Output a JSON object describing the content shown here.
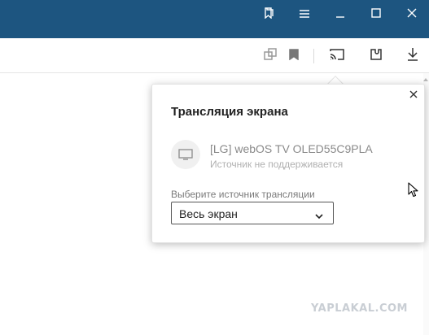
{
  "titlebar": {
    "icons": [
      "bookmarks-panel-icon",
      "menu-icon",
      "minimize-icon",
      "maximize-icon",
      "close-icon"
    ],
    "color": "#1d5580"
  },
  "toolbar": {
    "icons": [
      "translate-icon",
      "bookmark-icon",
      "cast-icon",
      "extensions-icon",
      "download-icon"
    ]
  },
  "popup": {
    "title": "Трансляция экрана",
    "device": {
      "name": "[LG] webOS TV OLED55C9PLA",
      "status": "Источник не поддерживается",
      "icon": "tv-icon"
    },
    "source_label": "Выберите источник трансляции",
    "source_value": "Весь экран"
  },
  "watermark": "YAPLAKAL.COM"
}
